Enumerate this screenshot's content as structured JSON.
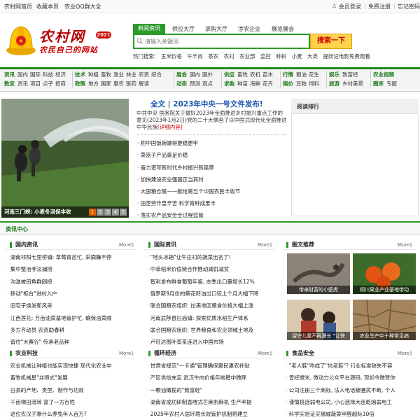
{
  "topbar": {
    "home": "农村网首页",
    "fav": "收藏本页",
    "qq": "农业QQ群大全",
    "login": "会员登录",
    "register": "免费注册",
    "forgot": "忘记密码"
  },
  "logo": {
    "title": "农村网",
    "year": "2021",
    "slogan": "农民自己的网站"
  },
  "search": {
    "tabs": [
      "新闻资讯",
      "供应大厅",
      "求购大厅",
      "涉农企业",
      "展览展会"
    ],
    "placeholder": "请输入关键词",
    "button": "搜索一下",
    "hot_label": "热门搜索:",
    "hot": [
      "玉米价格",
      "牛羊肉",
      "茶农",
      "农村",
      "农业部",
      "监控",
      "种树",
      "小麦",
      "大类",
      "提妖记电影免费观看"
    ]
  },
  "nav": {
    "groups": [
      {
        "head1": "资讯",
        "row1": [
          "国内",
          "国际",
          "科技",
          "经济"
        ],
        "head2": "数宜",
        "row2": [
          "资讯",
          "项目",
          "点子",
          "招商"
        ]
      },
      {
        "head1": "技术",
        "row1": [
          "种植",
          "畜牧",
          "渔业",
          "林业",
          "农资",
          "综合"
        ],
        "head2": "政策",
        "row2": [
          "地方",
          "国家",
          "惠农",
          "医药",
          "解读"
        ]
      },
      {
        "head1": "展会",
        "row1": [
          "国内",
          "国外"
        ],
        "head2": "动态",
        "row2": [
          "预测",
          "观点"
        ]
      },
      {
        "head1": "供应",
        "row1": [
          "畜牧",
          "农机",
          "苗木"
        ],
        "head2": "求购",
        "row2": [
          "种苗",
          "海鲜",
          "花卉"
        ]
      },
      {
        "head1": "行情",
        "row1": [
          "粮油",
          "花生"
        ],
        "head2": "猪价",
        "row2": [
          "豆粕",
          "饲料"
        ]
      },
      {
        "head1": "娱乐",
        "row1": [
          "致富经"
        ],
        "head2": "旅游",
        "row2": [
          "乡村美景"
        ]
      },
      {
        "head1": "农业视频",
        "row1": [],
        "head2": "图库",
        "row2": [
          "专题"
        ]
      }
    ]
  },
  "hero": {
    "caption": "河南三门峡: 小麦冬浇保丰收",
    "pages": [
      "1",
      "2",
      "3",
      "4",
      "5"
    ]
  },
  "headline": {
    "title": "全文 | 2023年中央一号文件发布!",
    "summary": "中共中央 国务院关于做好2023年全面推进乡村振兴重点工作的意见(2023年1月2日)党的二十大擘画了以中国式现代化全面推进中华民族",
    "detail": "[详细内容]",
    "items": [
      "把中国饭碗端得更稳更牢",
      "菜篮子产品量足价稳",
      "奋力谱写新时代乡村振兴新篇章",
      "加快建设农业强国正当其时",
      "大国粮仓赋一—献给第五个中国农民丰收节",
      "田垄劳作皇辛苦 科学育种成果丰",
      "落实农产品安全全过程监管"
    ]
  },
  "ranking": {
    "title": "阅读排行"
  },
  "center": {
    "title": "资讯中心",
    "more": "More》",
    "domestic": {
      "title": "国内资讯",
      "items": [
        "湖南祁阳七里桥镇: 草莓育苗忙, 采摘賺不停",
        "集中整治非法捕捞",
        "沟洫被田鱼群朗掠",
        "移动\"柜台\"进村入户",
        "旧宅子焕发新风采",
        "江西莲花: 万亩油菜基地管护忙, 确保油菜顺",
        "多方齐动员  农资助春耕",
        "留住\"大赛谷\"  传承老品种"
      ]
    },
    "international": {
      "title": "国际资讯",
      "items": [
        "\"地头冰箱\"让牛庄村的蔬菜出名了!",
        "中菲稻米价值链合作推动减饥减贫",
        "智利发布鲜食葡萄年鉴, 本季出口量增长12%",
        "俄罗斯9月份的葵花籽油出口较上个月大幅下降",
        "联合国粮农组织: 拉美地区粮食价格大幅上涨",
        "河南武陟县扫庙镇: 探索优质水稻生产体系",
        "联合国粮农组织: 世界粮食和农业领域土地及",
        "卢旺达图叶蒸茶连进入中国市场"
      ]
    },
    "pics": {
      "title": "图文推荐",
      "items": [
        "带来财富的小壁虎",
        "铜川果业产业基地带动",
        "留守儿童不再漫长 \"让快",
        "农业生产中十种常见病"
      ]
    },
    "tech": {
      "title": "农业科技",
      "items": [
        "农业机械让种植也能实现快捷 现代化农业中",
        "畜牧机械星\"井喷式\"发展",
        "白茶的产地、类型、制作与功效",
        "千亩梯田流转 富了一方百姓",
        "这位农汉子靠什么养兔年入百万?"
      ]
    },
    "cycle": {
      "title": "循环经济",
      "items": [
        "甘肃省规范\"一卡通\"管理确保惠民惠农补贴",
        "产区供给充足 武汉牛肉价格年前稳中微降",
        "一颗油橄榄的\"致富经\"",
        "湖南省成功研制直喂式芒麻割麻机 生产率提",
        "2025年农村人居环境长效管护机制将建立"
      ]
    },
    "safety": {
      "title": "食品安全",
      "items": [
        "\"老人鞋\"咋成了\"坑老鞋\"? 行业标准缺失不容",
        "曾经微米, 微动力公众平台源码, 现如今微赞你",
        "公司注册三个商标, 法人电话被骚扰不断, 个人",
        "谨慎挑选弱电公司, 小心选择大连乾熔弱电工",
        "科学实验证实挪威蔬菜甲醛超标10倍"
      ]
    }
  },
  "colors": {
    "green": "#2b9a2b",
    "red": "#cc0000",
    "blue": "#1a55b0"
  }
}
